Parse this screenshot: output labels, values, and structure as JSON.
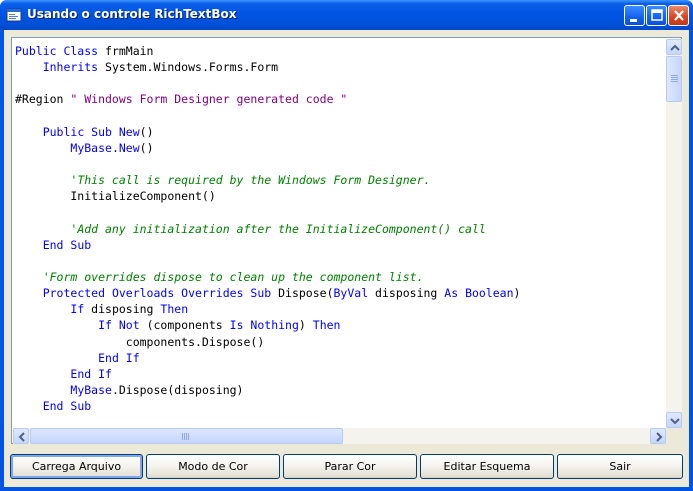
{
  "window": {
    "title": "Usando o controle RichTextBox",
    "icon": "form-icon",
    "controls": [
      "minimize-icon",
      "maximize-icon",
      "close-icon"
    ],
    "colors": {
      "titlebar": "#0054e3",
      "face": "#ece9d8",
      "keyword": "#0000ff",
      "comment": "#008000",
      "region": "#800080"
    }
  },
  "editor": {
    "lines": [
      [
        [
          "kw",
          "Public Class"
        ],
        [
          "t",
          " frmMain"
        ]
      ],
      [
        [
          "t",
          "    "
        ],
        [
          "kw",
          "Inherits"
        ],
        [
          "t",
          " System.Windows.Forms.Form"
        ]
      ],
      [],
      [
        [
          "t",
          "#Region "
        ],
        [
          "st",
          "\" Windows Form Designer generated code \""
        ]
      ],
      [],
      [
        [
          "t",
          "    "
        ],
        [
          "kw",
          "Public Sub New"
        ],
        [
          "t",
          "()"
        ]
      ],
      [
        [
          "t",
          "        "
        ],
        [
          "kw",
          "MyBase"
        ],
        [
          "t",
          "."
        ],
        [
          "kw",
          "New"
        ],
        [
          "t",
          "()"
        ]
      ],
      [],
      [
        [
          "t",
          "        "
        ],
        [
          "cm",
          "'This call is required by the Windows Form Designer."
        ]
      ],
      [
        [
          "t",
          "        InitializeComponent()"
        ]
      ],
      [],
      [
        [
          "t",
          "        "
        ],
        [
          "cm",
          "'Add any initialization after the InitializeComponent() call"
        ]
      ],
      [
        [
          "t",
          "    "
        ],
        [
          "kw",
          "End Sub"
        ]
      ],
      [],
      [
        [
          "t",
          "    "
        ],
        [
          "cm",
          "'Form overrides dispose to clean up the component list."
        ]
      ],
      [
        [
          "t",
          "    "
        ],
        [
          "kw",
          "Protected Overloads Overrides Sub"
        ],
        [
          "t",
          " Dispose("
        ],
        [
          "kw",
          "ByVal"
        ],
        [
          "t",
          " disposing "
        ],
        [
          "kw",
          "As Boolean"
        ],
        [
          "t",
          ")"
        ]
      ],
      [
        [
          "t",
          "        "
        ],
        [
          "kw",
          "If"
        ],
        [
          "t",
          " disposing "
        ],
        [
          "kw",
          "Then"
        ]
      ],
      [
        [
          "t",
          "            "
        ],
        [
          "kw",
          "If Not"
        ],
        [
          "t",
          " (components "
        ],
        [
          "kw",
          "Is Nothing"
        ],
        [
          "t",
          ") "
        ],
        [
          "kw",
          "Then"
        ]
      ],
      [
        [
          "t",
          "                components.Dispose()"
        ]
      ],
      [
        [
          "t",
          "            "
        ],
        [
          "kw",
          "End If"
        ]
      ],
      [
        [
          "t",
          "        "
        ],
        [
          "kw",
          "End If"
        ]
      ],
      [
        [
          "t",
          "        "
        ],
        [
          "kw",
          "MyBase"
        ],
        [
          "t",
          ".Dispose(disposing)"
        ]
      ],
      [
        [
          "t",
          "    "
        ],
        [
          "kw",
          "End Sub"
        ]
      ]
    ]
  },
  "buttons": {
    "load": "Carrega Arquivo",
    "color_mode": "Modo de Cor",
    "stop_color": "Parar Cor",
    "edit_scheme": "Editar Esquema",
    "exit": "Sair"
  }
}
